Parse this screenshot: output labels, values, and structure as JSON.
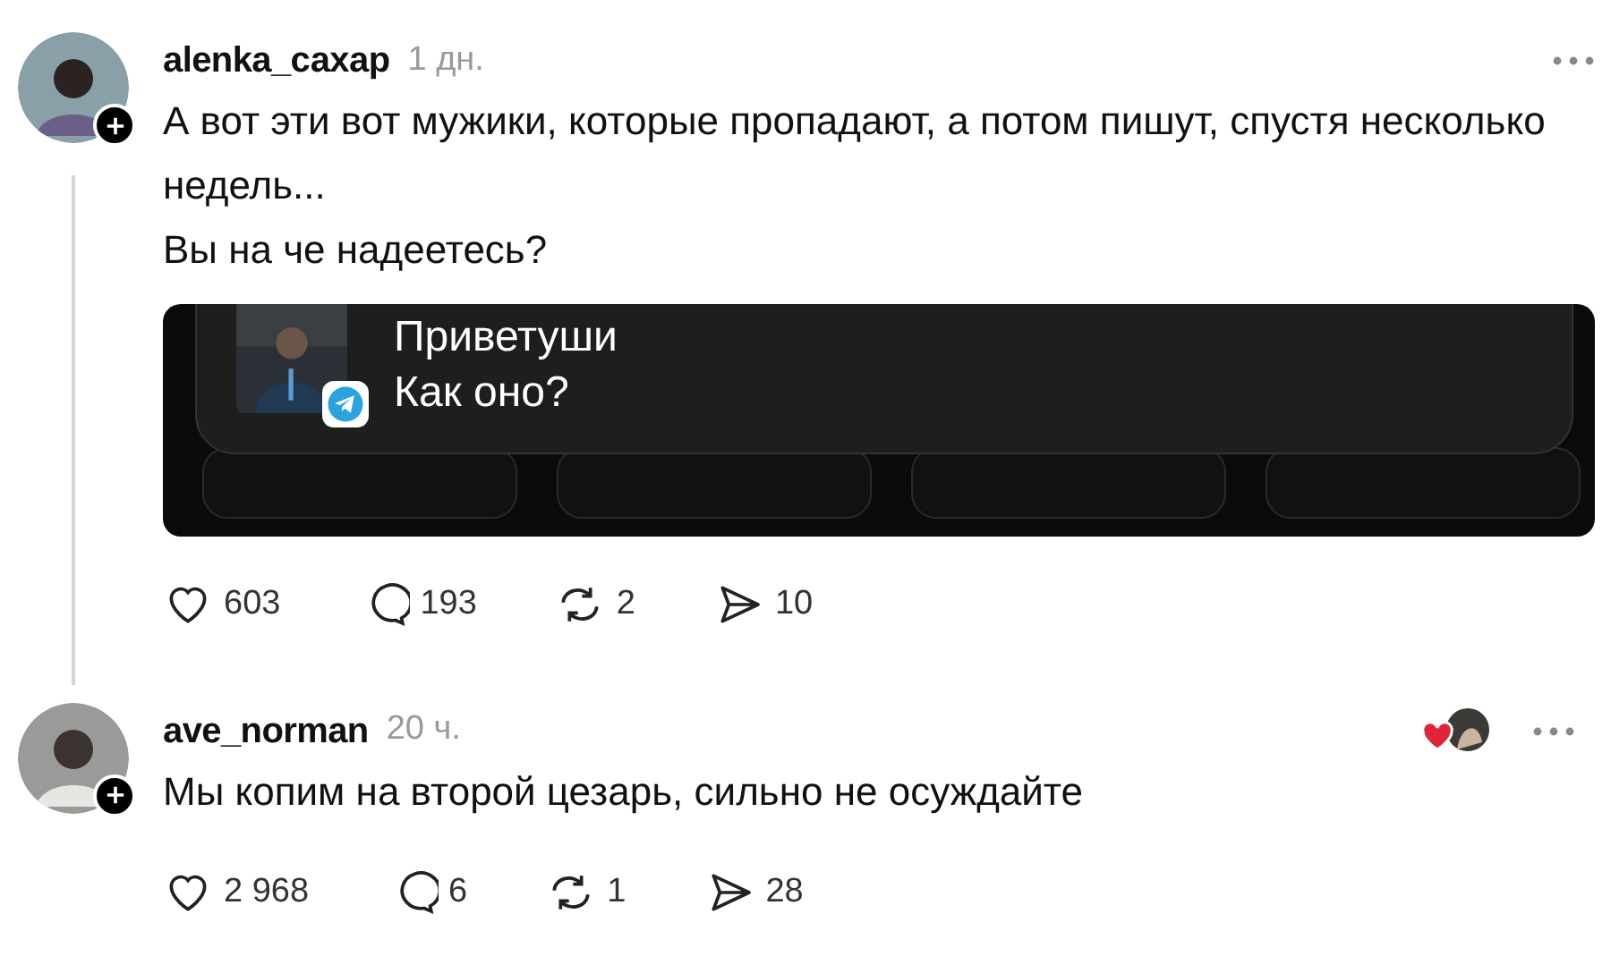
{
  "posts": [
    {
      "username": "alenka_сахар",
      "time": "1 дн.",
      "lines": [
        "А вот эти вот мужики, которые пропадают, а потом пишут, спустя несколько недель...",
        "Вы на че надеетесь?"
      ],
      "thread_line": true,
      "liked_by_author": false,
      "attachment": {
        "kind": "screenshot",
        "notification": {
          "title": "Приветуши",
          "message": "Как оно?"
        }
      },
      "stats": {
        "likes": "603",
        "comments": "193",
        "reposts": "2",
        "shares": "10"
      }
    },
    {
      "username": "ave_norman",
      "time": "20 ч.",
      "lines": [
        "Мы копим на второй цезарь, сильно не осуждайте"
      ],
      "thread_line": false,
      "liked_by_author": true,
      "stats": {
        "likes": "2 968",
        "comments": "6",
        "reposts": "1",
        "shares": "28"
      }
    }
  ]
}
